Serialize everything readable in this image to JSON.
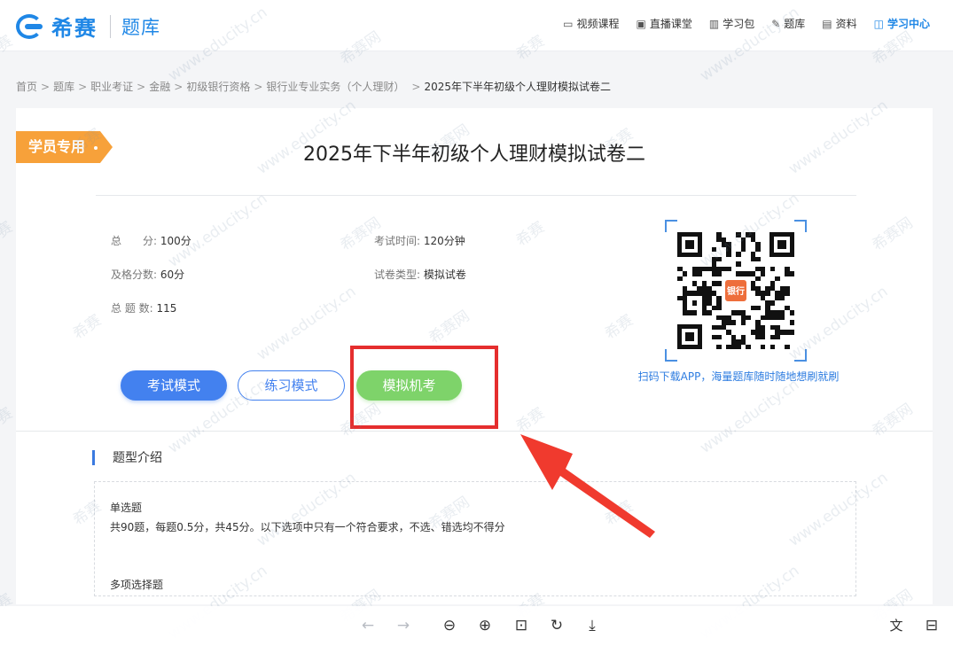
{
  "brand": {
    "name": "希赛",
    "section": "题库"
  },
  "nav": [
    {
      "icon": "video-icon",
      "glyph": "▭",
      "label": "视频课程"
    },
    {
      "icon": "live-icon",
      "glyph": "▣",
      "label": "直播课堂"
    },
    {
      "icon": "package-icon",
      "glyph": "▥",
      "label": "学习包"
    },
    {
      "icon": "question-bank-icon",
      "glyph": "✎",
      "label": "题库"
    },
    {
      "icon": "document-icon",
      "glyph": "▤",
      "label": "资料"
    },
    {
      "icon": "book-icon",
      "glyph": "◫",
      "label": "学习中心"
    }
  ],
  "breadcrumb": [
    "首页",
    "题库",
    "职业考证",
    "金融",
    "初级银行资格",
    "银行业专业实务（个人理财）"
  ],
  "breadcrumb_sep": ">",
  "breadcrumb_current": "2025年下半年初级个人理财模拟试卷二",
  "ribbon": "学员专用",
  "exam_title": "2025年下半年初级个人理财模拟试卷二",
  "info": {
    "total_label": "总　　分:",
    "total_value": "100分",
    "pass_label": "及格分数:",
    "pass_value": "60分",
    "count_label": "总 题 数:",
    "count_value": "115",
    "time_label": "考试时间:",
    "time_value": "120分钟",
    "type_label": "试卷类型:",
    "type_value": "模拟试卷"
  },
  "qr": {
    "logo_text": "银行",
    "caption": "扫码下载APP，海量题库随时随地想刷就刷"
  },
  "buttons": {
    "exam_mode": "考试模式",
    "practice_mode": "练习模式",
    "mock_exam": "模拟机考"
  },
  "section_title": "题型介绍",
  "question_types": [
    {
      "name": "单选题",
      "desc": "共90题，每题0.5分，共45分。以下选项中只有一个符合要求，不选、错选均不得分"
    },
    {
      "name": "多项选择题",
      "desc": ""
    }
  ],
  "watermark": {
    "brand": "希赛",
    "site": "www.educity.cn",
    "site_cn": "希赛网"
  },
  "toolbar": [
    {
      "name": "back-arrow-icon",
      "glyph": "←",
      "disabled": true
    },
    {
      "name": "forward-arrow-icon",
      "glyph": "→",
      "disabled": true
    },
    {
      "name": "zoom-out-icon",
      "glyph": "⊖",
      "disabled": false
    },
    {
      "name": "zoom-in-icon",
      "glyph": "⊕",
      "disabled": false
    },
    {
      "name": "fit-page-icon",
      "glyph": "⊡",
      "disabled": false
    },
    {
      "name": "rotate-icon",
      "glyph": "↻",
      "disabled": false
    },
    {
      "name": "download-icon",
      "glyph": "⤓",
      "disabled": false
    },
    {
      "name": "translate-icon",
      "glyph": "文",
      "disabled": false
    },
    {
      "name": "text-scan-icon",
      "glyph": "⊟",
      "disabled": false
    }
  ],
  "colors": {
    "brand_blue": "#1f87e6",
    "ribbon_orange": "#f7a13a",
    "highlight_red": "#e52e2e",
    "mock_green": "#7ed36a",
    "exam_blue": "#4381ef"
  }
}
